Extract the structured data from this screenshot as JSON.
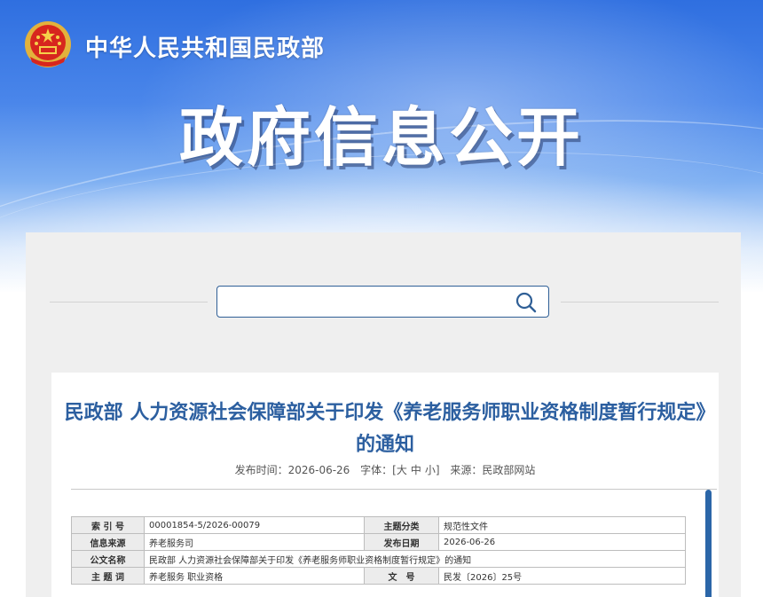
{
  "header": {
    "ministry_name": "中华人民共和国民政部",
    "hero_title": "政府信息公开",
    "emblem_icon": "national-emblem-icon"
  },
  "search": {
    "placeholder": "",
    "value": "",
    "icon": "search-icon"
  },
  "article": {
    "title": "民政部 人力资源社会保障部关于印发《养老服务师职业资格制度暂行规定》的通知",
    "meta": {
      "publish_label": "发布时间：",
      "publish_date": "2026-06-26",
      "font_label": "字体：[",
      "font_large": "大",
      "font_medium": "中",
      "font_small": "小",
      "font_close": "]",
      "source_label": "来源：",
      "source": "民政部网站"
    }
  },
  "info_table": {
    "rows": [
      {
        "k1": "索 引 号",
        "v1": "00001854-5/2026-00079",
        "k2": "主题分类",
        "v2": "规范性文件"
      },
      {
        "k1": "信息来源",
        "v1": "养老服务司",
        "k2": "发布日期",
        "v2": "2026-06-26"
      },
      {
        "k1": "公文名称",
        "v1": "民政部 人力资源社会保障部关于印发《养老服务师职业资格制度暂行规定》的通知"
      },
      {
        "k1": "主 题 词",
        "v1": "养老服务 职业资格",
        "k2": "文　号",
        "v2": "民发〔2026〕25号"
      }
    ]
  },
  "colors": {
    "title_blue": "#2c5fa0",
    "hero_blue": "#2f6fe0",
    "scrollbar": "#2b66a8"
  }
}
